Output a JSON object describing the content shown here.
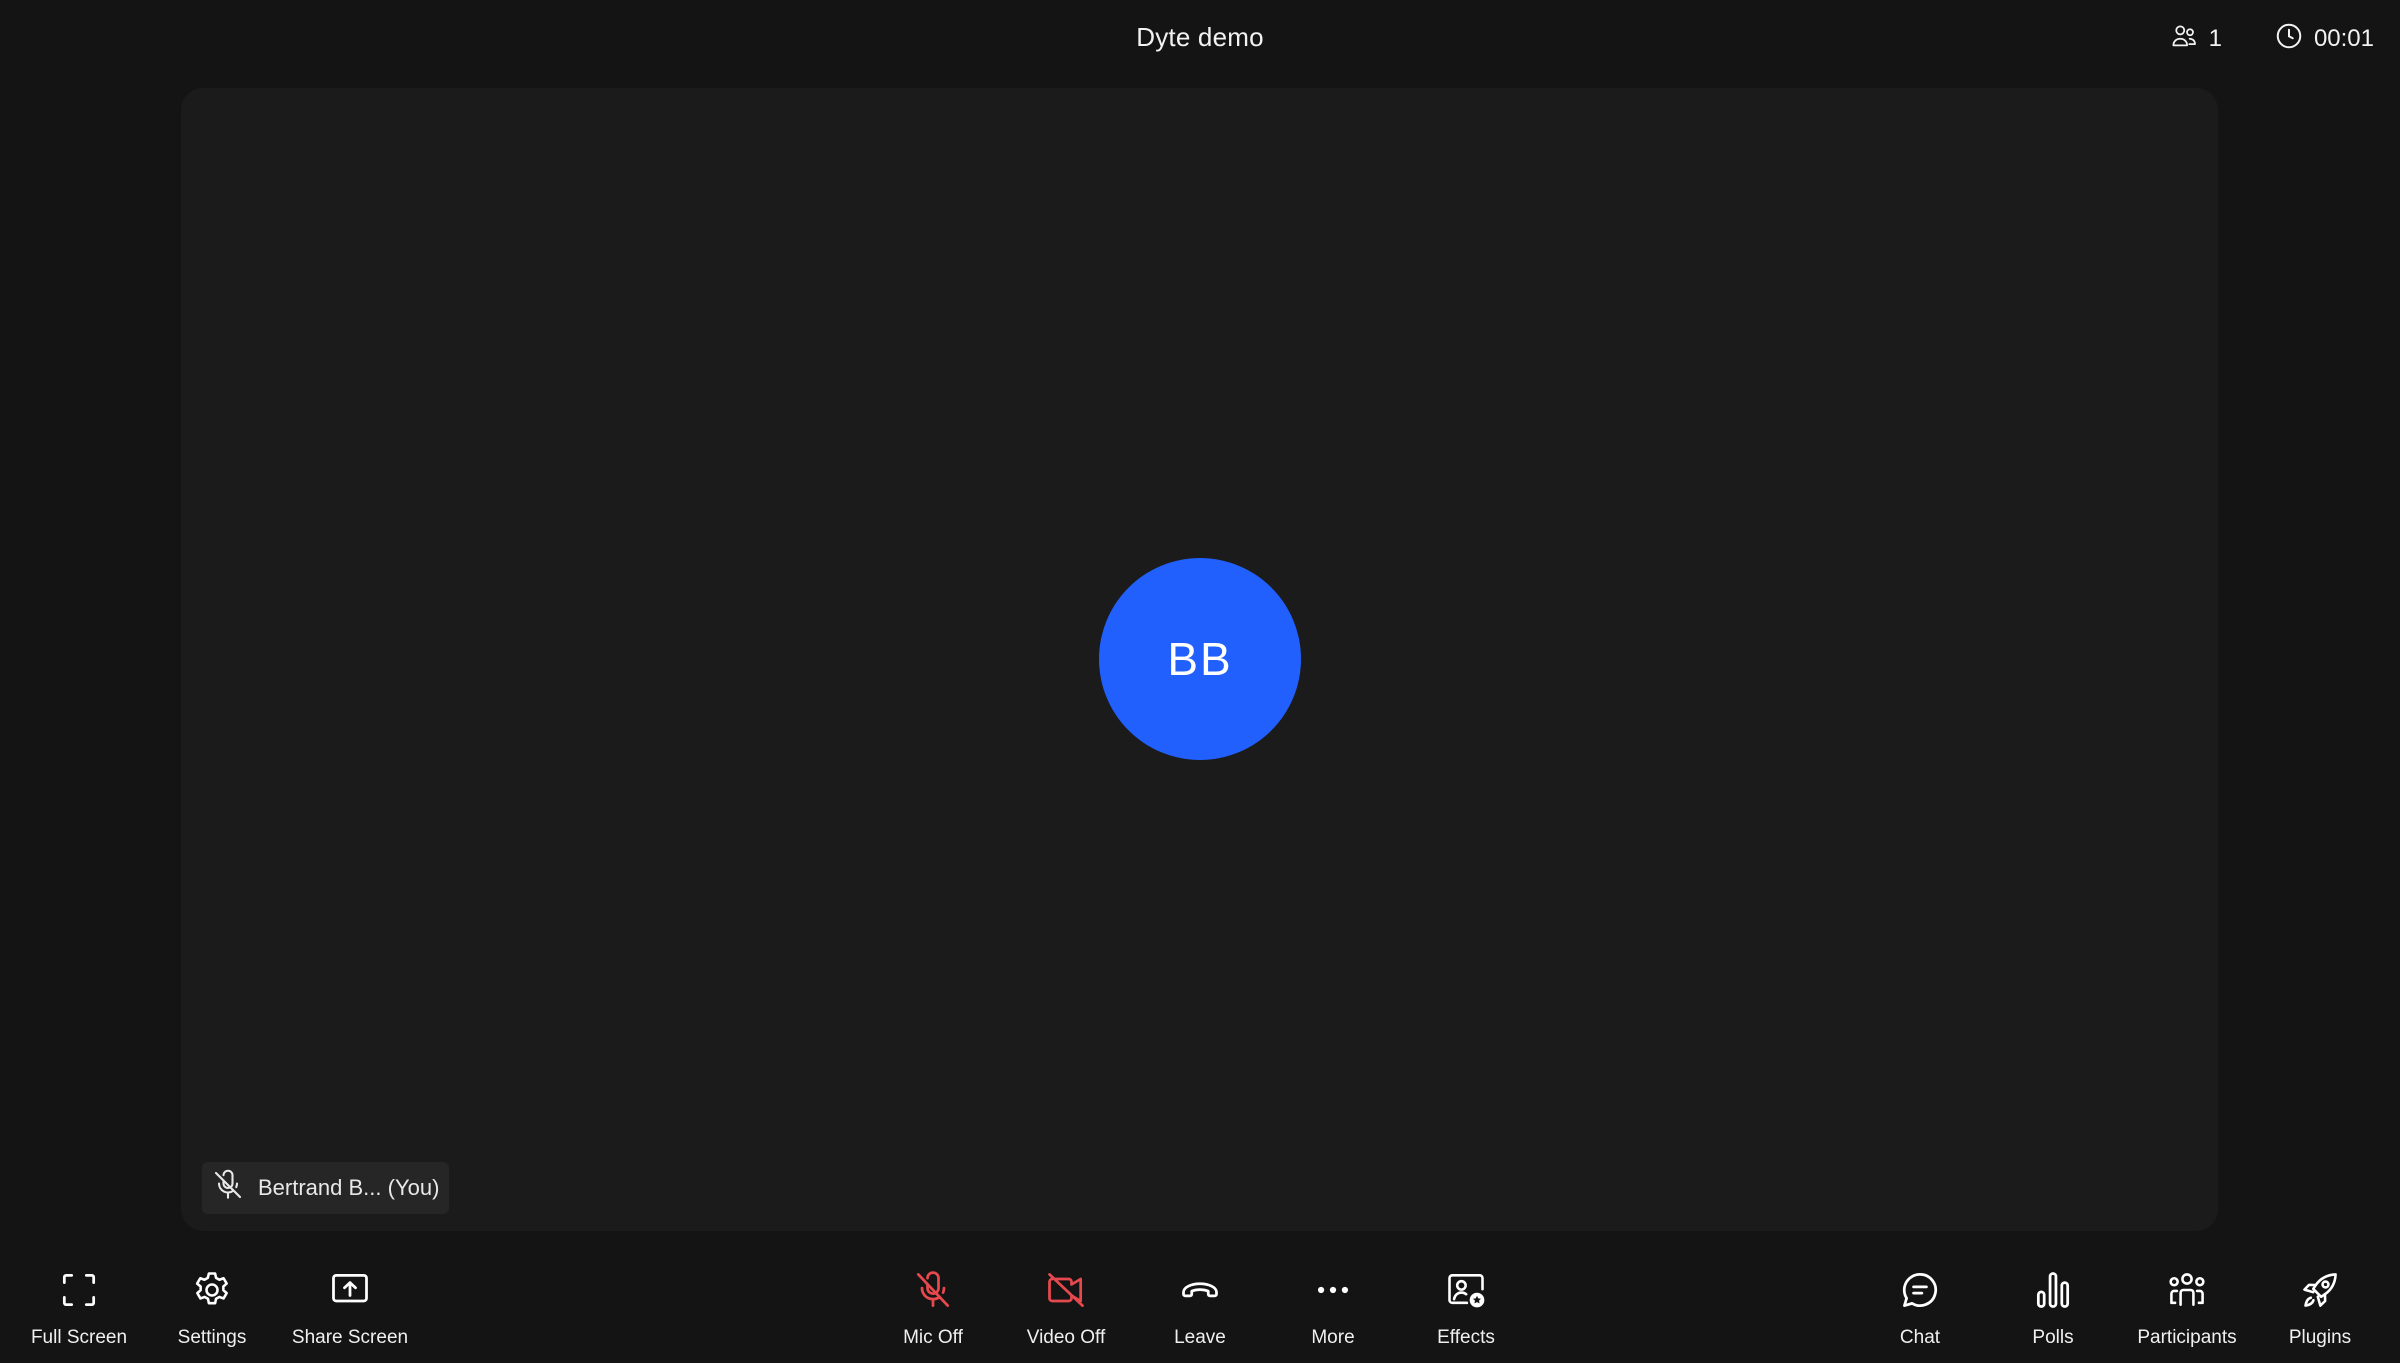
{
  "header": {
    "title": "Dyte demo",
    "participant_count": "1",
    "participants_icon": "participants-icon",
    "timer": "00:01",
    "timer_icon": "clock-icon"
  },
  "stage": {
    "avatar_initials": "BB",
    "avatar_color": "#2160fd",
    "name_tag": "Bertrand B... (You)",
    "name_tag_icon": "mic-off-icon"
  },
  "controls": {
    "left": [
      {
        "label": "Full Screen",
        "icon": "fullscreen-icon"
      },
      {
        "label": "Settings",
        "icon": "gear-icon"
      },
      {
        "label": "Share Screen",
        "icon": "share-screen-icon"
      }
    ],
    "center": [
      {
        "label": "Mic Off",
        "icon": "mic-off-icon",
        "color": "#e5484d"
      },
      {
        "label": "Video Off",
        "icon": "video-off-icon",
        "color": "#e5484d"
      },
      {
        "label": "Leave",
        "icon": "leave-call-icon"
      },
      {
        "label": "More",
        "icon": "more-icon"
      },
      {
        "label": "Effects",
        "icon": "effects-icon"
      }
    ],
    "right": [
      {
        "label": "Chat",
        "icon": "chat-icon"
      },
      {
        "label": "Polls",
        "icon": "polls-icon"
      },
      {
        "label": "Participants",
        "icon": "participants-icon"
      },
      {
        "label": "Plugins",
        "icon": "rocket-icon"
      }
    ]
  },
  "colors": {
    "background": "#141414",
    "stage": "#1b1b1b",
    "danger": "#e5484d",
    "text": "#ffffff"
  }
}
